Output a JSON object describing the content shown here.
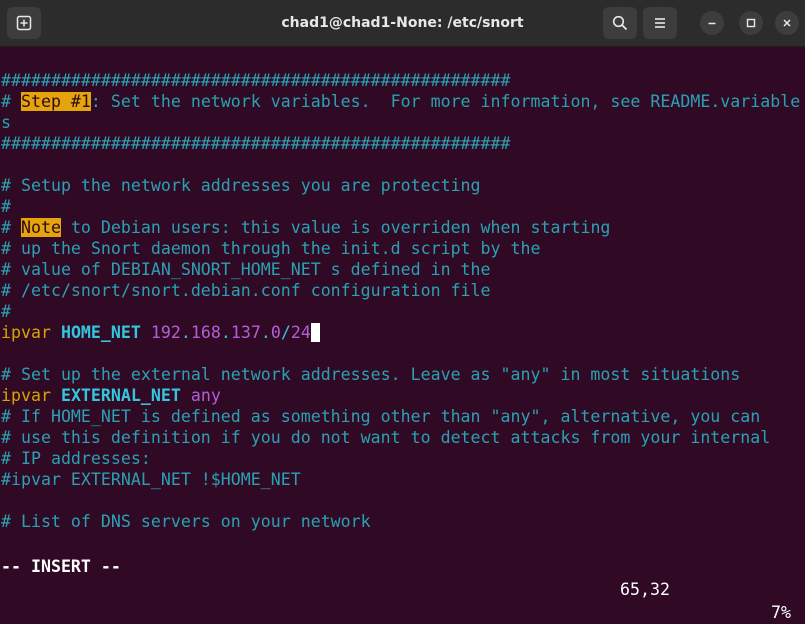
{
  "window": {
    "title": "chad1@chad1-None: /etc/snort",
    "newtab_icon": "new-tab-icon",
    "search_icon": "search-icon",
    "menu_icon": "hamburger-menu-icon",
    "minimize_icon": "minimize-icon",
    "maximize_icon": "maximize-icon",
    "close_icon": "close-icon"
  },
  "editor": {
    "l1": "###################################################",
    "l2_prefix": "# ",
    "l2_hl": "Step #1",
    "l2_rest": ": Set the network variables.  For more information, see README.variable",
    "l3": "s",
    "l4": "###################################################",
    "l5": "",
    "l6": "# Setup the network addresses you are protecting",
    "l7": "#",
    "l8_prefix": "# ",
    "l8_hl": "Note",
    "l8_rest": " to Debian users: this value is overriden when starting",
    "l9": "# up the Snort daemon through the init.d script by the",
    "l10": "# value of DEBIAN_SNORT_HOME_NET s defined in the",
    "l11": "# /etc/snort/snort.debian.conf configuration file",
    "l12": "#",
    "l13_kw": "ipvar",
    "l13_id": "HOME_NET",
    "l13_a": "192",
    "l13_b": "168",
    "l13_c": "137",
    "l13_d": "0",
    "l13_e": "24",
    "l14": "",
    "l15": "# Set up the external network addresses. Leave as \"any\" in most situations",
    "l16_kw": "ipvar",
    "l16_id": "EXTERNAL_NET",
    "l16_val": "any",
    "l17": "# If HOME_NET is defined as something other than \"any\", alternative, you can",
    "l18": "# use this definition if you do not want to detect attacks from your internal",
    "l19": "# IP addresses:",
    "l20": "#ipvar EXTERNAL_NET !$HOME_NET",
    "l21": "",
    "l22": "# List of DNS servers on your network"
  },
  "status": {
    "mode": "-- INSERT --",
    "position": "65,32",
    "percent": "7%"
  },
  "colors": {
    "terminal_bg": "#300a24",
    "comment": "#2aa1b3",
    "highlight": "#e5a50a",
    "keyword": "#d8a400",
    "identifier": "#33c7de",
    "number": "#b25fd5"
  }
}
